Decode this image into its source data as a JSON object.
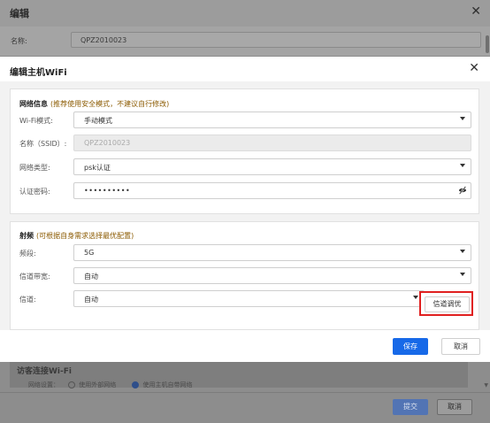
{
  "background": {
    "title": "编辑",
    "close_glyph": "✕",
    "name_label": "名称:",
    "name_value": "QPZ2010023",
    "guest_title": "访客连接Wi-Fi",
    "guest_label": "网络设置：",
    "guest_option_1": "使用外部网络",
    "guest_option_2": "使用主机自带网络",
    "submit_label": "提交",
    "cancel_label": "取消"
  },
  "modal": {
    "title": "编辑主机WiFi",
    "close_glyph": "✕",
    "network_section": {
      "title": "网络信息",
      "hint": "(推荐使用安全模式，不建议自行修改)",
      "fields": [
        {
          "label": "Wi-Fi模式:",
          "value": "手动模式"
        },
        {
          "label": "名称（SSID）:",
          "value": "QPZ2010023"
        },
        {
          "label": "网络类型:",
          "value": "psk认证"
        },
        {
          "label": "认证密码:",
          "value": "••••••••••"
        }
      ]
    },
    "radio_section": {
      "title": "射频",
      "hint": "(可根据自身需求选择最优配置)",
      "fields": [
        {
          "label": "频段:",
          "value": "5G"
        },
        {
          "label": "信道带宽:",
          "value": "自动"
        },
        {
          "label": "信道:",
          "value": "自动"
        }
      ],
      "tune_label": "信道调优"
    },
    "save_label": "保存",
    "cancel_label": "取消"
  },
  "colors": {
    "primary": "#1769e8",
    "hint": "#8b5a00",
    "highlight": "#e02020"
  }
}
